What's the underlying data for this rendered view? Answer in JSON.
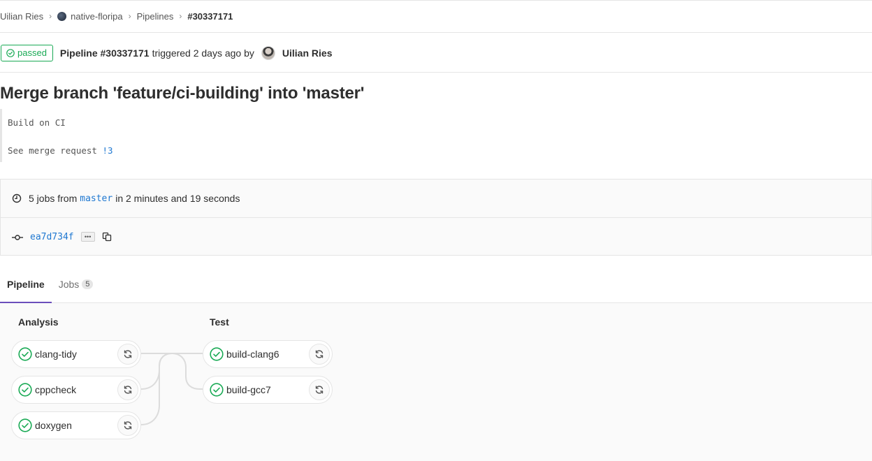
{
  "breadcrumb": {
    "user": "Uilian Ries",
    "project": "native-floripa",
    "section": "Pipelines",
    "current": "#30337171"
  },
  "header": {
    "status": "passed",
    "pipeline": "Pipeline #30337171",
    "triggered": "triggered 2 days ago by",
    "user": "Uilian Ries"
  },
  "commit": {
    "title": "Merge branch 'feature/ci-building' into 'master'",
    "line1": "Build on CI",
    "line2_prefix": "See merge request ",
    "mr_ref": "!3"
  },
  "info": {
    "jobs_prefix": "5 jobs from",
    "branch": "master",
    "duration": "in 2 minutes and 19 seconds",
    "sha": "ea7d734f",
    "more_label": "•••"
  },
  "tabs": [
    {
      "label": "Pipeline"
    },
    {
      "label": "Jobs",
      "count": "5"
    }
  ],
  "stages": [
    {
      "title": "Analysis",
      "jobs": [
        "clang-tidy",
        "cppcheck",
        "doxygen"
      ]
    },
    {
      "title": "Test",
      "jobs": [
        "build-clang6",
        "build-gcc7"
      ]
    }
  ],
  "colors": {
    "success": "#1aaa55",
    "link": "#1f78d1",
    "active_tab": "#6b4fbb"
  },
  "icons": {
    "status": "check-circle-icon",
    "clock": "clock-icon",
    "commit": "commit-icon",
    "copy": "copy-icon",
    "retry": "retry-icon"
  }
}
